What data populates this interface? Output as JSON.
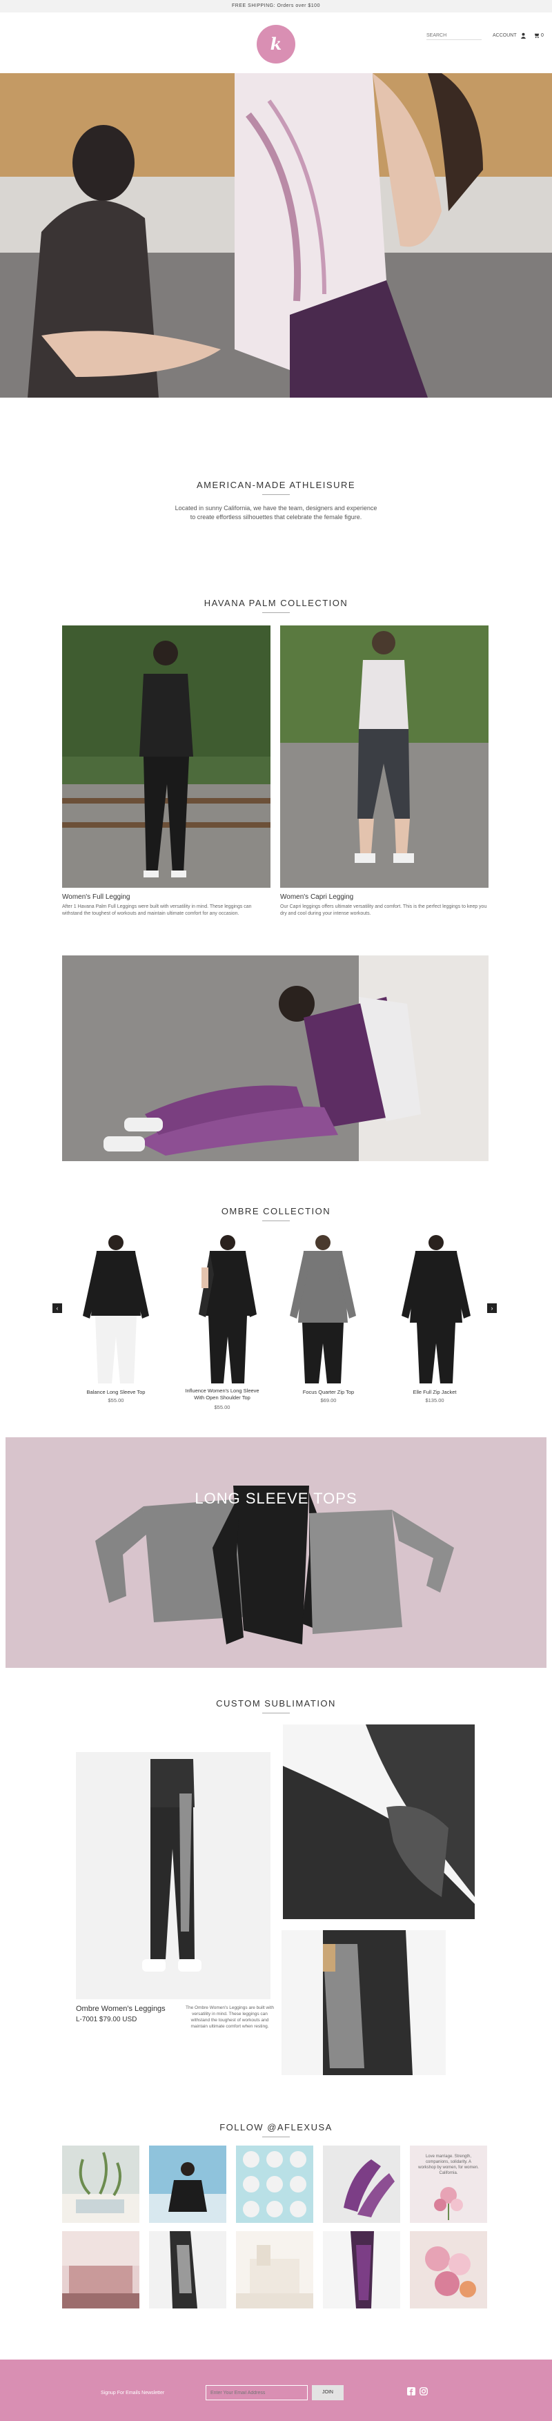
{
  "announcement": "FREE SHIPPING: Orders over $100",
  "header": {
    "logo_text": "k",
    "search_placeholder": "SEARCH",
    "account_label": "ACCOUNT",
    "cart_count": "0"
  },
  "hero": {
    "alt": ""
  },
  "intro": {
    "title": "AMERICAN-MADE ATHLEISURE",
    "line1": "Located in sunny California, we have the team, designers and experience",
    "line2": "to create effortless silhouettes that celebrate the female figure."
  },
  "havana": {
    "title": "HAVANA PALM COLLECTION",
    "items": [
      {
        "title": "Women's Full Legging",
        "body": "After 1 Havana Palm Full Leggings were built with versatility in mind. These leggings can withstand the toughest of workouts and maintain ultimate comfort for any occasion."
      },
      {
        "title": "Women's Capri Legging",
        "body": "Our Capri leggings offers ultimate versatility and comfort. This is the perfect leggings to keep you dry and cool during your intense workouts."
      }
    ]
  },
  "ombre": {
    "title": "OMBRE COLLECTION",
    "prev": "‹",
    "next": "›",
    "products": [
      {
        "name": "Balance Long Sleeve Top",
        "price": "$55.00"
      },
      {
        "name": "Influence Women's Long Sleeve With Open Shoulder Top",
        "price": "$55.00"
      },
      {
        "name": "Focus Quarter Zip Top",
        "price": "$69.00"
      },
      {
        "name": "Elle Full Zip Jacket",
        "price": "$135.00"
      }
    ]
  },
  "banner": {
    "text": "LONG SLEEVE TOPS"
  },
  "sublimation": {
    "title": "CUSTOM SUBLIMATION",
    "product_name": "Ombre Women's Leggings",
    "product_sku_price": "L-7001 $79.00 USD",
    "product_desc": "The Ombre Women's Leggings are built with versatility in mind. These leggings can withstand the toughest of workouts and maintain ultimate comfort when resting."
  },
  "instagram": {
    "title": "FOLLOW @AFLEXUSA",
    "quote": "Love marriage. Strength, companions, solidarity. A workshop by women, for women. California."
  },
  "footer": {
    "signup_label": "Signup For Emails Newsletter",
    "email_placeholder": "Enter Your Email Address",
    "join_label": "JOIN"
  },
  "colors": {
    "brand_pink": "#d98fb3",
    "banner_pink": "#d8c4cc"
  }
}
